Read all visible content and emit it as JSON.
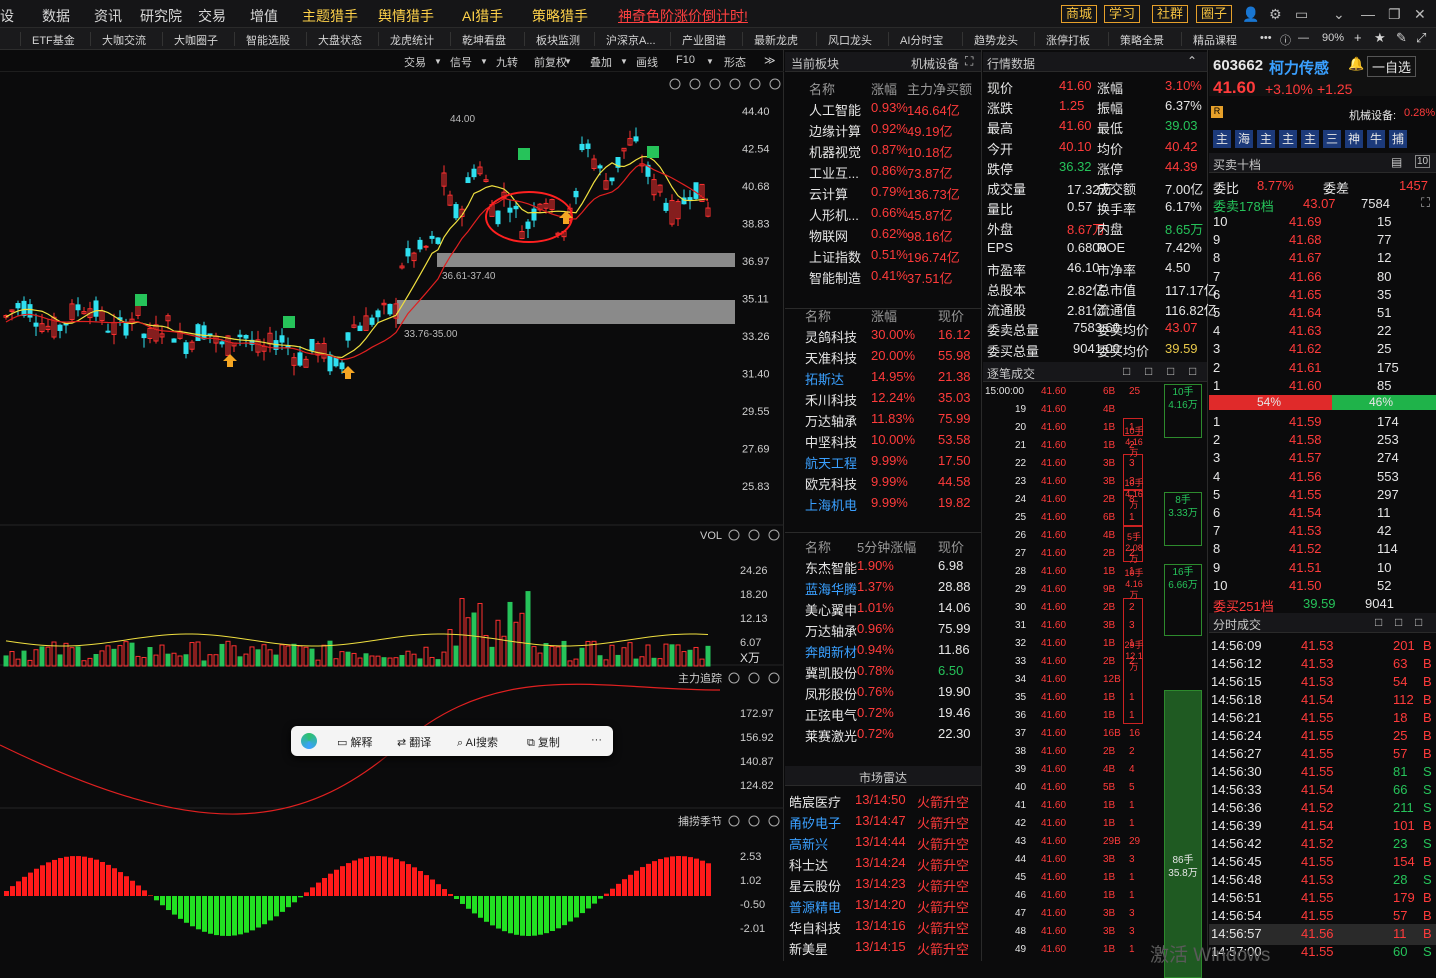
{
  "menu": [
    "设",
    "数据",
    "资讯",
    "研究院",
    "交易",
    "增值",
    "主题猎手",
    "舆情猎手",
    "AI猎手",
    "策略猎手"
  ],
  "promo": "神奇色阶涨价倒计时!",
  "top_buttons": [
    "商城",
    "学习",
    "社群",
    "圈子"
  ],
  "nav": [
    "",
    "ETF基金",
    "大咖交流",
    "大咖圈子",
    "智能选股",
    "大盘状态",
    "龙虎统计",
    "乾坤看盘",
    "板块监测",
    "沪深京A...",
    "产业图谱",
    "最新龙虎",
    "风口龙头",
    "AI分时宝",
    "趋势龙头",
    "涨停打板",
    "策略全景",
    "精品课程"
  ],
  "zoom": "90%",
  "chart_toolbar": [
    "交易",
    "信号",
    "九转",
    "前复权",
    "叠加",
    "画线",
    "F10",
    "形态"
  ],
  "price_axis": [
    "44.40",
    "42.54",
    "40.68",
    "38.83",
    "36.97",
    "35.11",
    "33.26",
    "31.40",
    "29.55",
    "27.69",
    "25.83"
  ],
  "price_marks": {
    "high": "44.00",
    "zone1": "36.61-37.40",
    "zone2": "33.76-35.00"
  },
  "vol": {
    "label": "VOL",
    "axis": [
      "24.26",
      "18.20",
      "12.13",
      "6.07"
    ],
    "unit": "X万"
  },
  "main_track": {
    "label": "主力追踪",
    "axis": [
      "172.97",
      "156.92",
      "140.87",
      "124.82"
    ]
  },
  "season": {
    "label": "捕捞季节",
    "axis": [
      "2.53",
      "1.02",
      "-0.50",
      "-2.01"
    ]
  },
  "ctx_menu": [
    "解释",
    "翻译",
    "AI搜索",
    "复制",
    "···"
  ],
  "sector": {
    "title": "当前板块",
    "current": "机械设备",
    "cols": [
      "名称",
      "涨幅",
      "主力净买额"
    ],
    "rows": [
      [
        "人工智能",
        "0.93%",
        "146.64亿"
      ],
      [
        "边缘计算",
        "0.92%",
        "49.19亿"
      ],
      [
        "机器视觉",
        "0.87%",
        "10.18亿"
      ],
      [
        "工业互...",
        "0.86%",
        "73.87亿"
      ],
      [
        "云计算",
        "0.79%",
        "136.73亿"
      ],
      [
        "人形机...",
        "0.66%",
        "45.87亿"
      ],
      [
        "物联网",
        "0.62%",
        "98.16亿"
      ],
      [
        "上证指数",
        "0.51%",
        "196.74亿"
      ],
      [
        "智能制造",
        "0.41%",
        "37.51亿"
      ]
    ]
  },
  "leaders": {
    "cols": [
      "名称",
      "涨幅",
      "现价"
    ],
    "rows": [
      [
        "灵鸽科技",
        "30.00%",
        "16.12"
      ],
      [
        "天准科技",
        "20.00%",
        "55.98"
      ],
      [
        "拓斯达",
        "14.95%",
        "21.38"
      ],
      [
        "禾川科技",
        "12.24%",
        "35.03"
      ],
      [
        "万达轴承",
        "11.83%",
        "75.99"
      ],
      [
        "中坚科技",
        "10.00%",
        "53.58"
      ],
      [
        "航天工程",
        "9.99%",
        "17.50"
      ],
      [
        "欧克科技",
        "9.99%",
        "44.58"
      ],
      [
        "上海机电",
        "9.99%",
        "19.82"
      ]
    ]
  },
  "five_min": {
    "cols": [
      "名称",
      "5分钟涨幅",
      "现价"
    ],
    "rows": [
      [
        "东杰智能",
        "1.90%",
        "6.98"
      ],
      [
        "蓝海华腾",
        "1.37%",
        "28.88"
      ],
      [
        "美心翼申",
        "1.01%",
        "14.06"
      ],
      [
        "万达轴承",
        "0.96%",
        "75.99"
      ],
      [
        "奔朗新材",
        "0.94%",
        "11.86"
      ],
      [
        "冀凯股份",
        "0.78%",
        "6.50"
      ],
      [
        "凤形股份",
        "0.76%",
        "19.90"
      ],
      [
        "正弦电气",
        "0.72%",
        "19.46"
      ],
      [
        "莱赛激光",
        "0.72%",
        "22.30"
      ]
    ]
  },
  "radar": {
    "title": "市场雷达",
    "rows": [
      [
        "皓宸医疗",
        "13/14:50",
        "火箭升空"
      ],
      [
        "甬矽电子",
        "13/14:47",
        "火箭升空"
      ],
      [
        "高新兴",
        "13/14:44",
        "火箭升空"
      ],
      [
        "科士达",
        "13/14:24",
        "火箭升空"
      ],
      [
        "星云股份",
        "13/14:23",
        "火箭升空"
      ],
      [
        "普源精电",
        "13/14:20",
        "火箭升空"
      ],
      [
        "华自科技",
        "13/14:16",
        "火箭升空"
      ],
      [
        "新美星",
        "13/14:15",
        "火箭升空"
      ]
    ]
  },
  "quote": {
    "title": "行情数据",
    "rows": [
      [
        "现价",
        "41.60",
        "涨幅",
        "3.10%"
      ],
      [
        "涨跌",
        "1.25",
        "振幅",
        "6.37%"
      ],
      [
        "最高",
        "41.60",
        "最低",
        "39.03"
      ],
      [
        "今开",
        "40.10",
        "均价",
        "40.42"
      ],
      [
        "跌停",
        "36.32",
        "涨停",
        "44.39"
      ],
      [
        "成交量",
        "17.32万",
        "成交额",
        "7.00亿"
      ],
      [
        "量比",
        "0.57",
        "换手率",
        "6.17%"
      ],
      [
        "外盘",
        "8.67万",
        "内盘",
        "8.65万"
      ],
      [
        "EPS",
        "0.6800",
        "ROE",
        "7.42%"
      ],
      [
        "市盈率",
        "46.10",
        "市净率",
        "4.50"
      ],
      [
        "总股本",
        "2.82亿",
        "总市值",
        "117.17亿"
      ],
      [
        "流通股",
        "2.81亿",
        "流通值",
        "116.82亿"
      ],
      [
        "委卖总量",
        "7583.60",
        "委卖均价",
        "43.07"
      ],
      [
        "委买总量",
        "9041.00",
        "委买均价",
        "39.59"
      ]
    ]
  },
  "ticks": {
    "title": "逐笔成交",
    "first_time": "15:00:00",
    "rows": [
      [
        "",
        "41.60",
        "6B",
        "25"
      ],
      [
        "19",
        "41.60",
        "4B",
        ""
      ],
      [
        "20",
        "41.60",
        "1B",
        "1"
      ],
      [
        "21",
        "41.60",
        "1B",
        "2"
      ],
      [
        "22",
        "41.60",
        "3B",
        "3"
      ],
      [
        "23",
        "41.60",
        "3B",
        "3"
      ],
      [
        "24",
        "41.60",
        "2B",
        "8"
      ],
      [
        "25",
        "41.60",
        "6B",
        "1"
      ],
      [
        "26",
        "41.60",
        "4B",
        ""
      ],
      [
        "27",
        "41.60",
        "2B",
        "2"
      ],
      [
        "28",
        "41.60",
        "1B",
        "1"
      ],
      [
        "29",
        "41.60",
        "9B",
        ""
      ],
      [
        "30",
        "41.60",
        "2B",
        "2"
      ],
      [
        "31",
        "41.60",
        "3B",
        "3"
      ],
      [
        "32",
        "41.60",
        "1B",
        "1"
      ],
      [
        "33",
        "41.60",
        "2B",
        "2"
      ],
      [
        "34",
        "41.60",
        "12B",
        ""
      ],
      [
        "35",
        "41.60",
        "1B",
        "1"
      ],
      [
        "36",
        "41.60",
        "1B",
        "1"
      ],
      [
        "37",
        "41.60",
        "16B",
        "16"
      ],
      [
        "38",
        "41.60",
        "2B",
        "2"
      ],
      [
        "39",
        "41.60",
        "4B",
        "4"
      ],
      [
        "40",
        "41.60",
        "5B",
        "5"
      ],
      [
        "41",
        "41.60",
        "1B",
        "1"
      ],
      [
        "42",
        "41.60",
        "1B",
        "1"
      ],
      [
        "43",
        "41.60",
        "29B",
        "29"
      ],
      [
        "44",
        "41.60",
        "3B",
        "3"
      ],
      [
        "45",
        "41.60",
        "1B",
        "1"
      ],
      [
        "46",
        "41.60",
        "1B",
        "1"
      ],
      [
        "47",
        "41.60",
        "3B",
        "3"
      ],
      [
        "48",
        "41.60",
        "3B",
        "3"
      ],
      [
        "49",
        "41.60",
        "1B",
        "1"
      ]
    ],
    "blocks_a": [
      [
        "10手",
        "4.16万"
      ],
      [
        "10手",
        "4.16万"
      ],
      [
        "5手",
        "2.08万"
      ],
      [
        "10手",
        "4.16万"
      ],
      [
        "29手",
        "12.1万"
      ]
    ],
    "blocks_b": [
      [
        "10手",
        "4.16万"
      ],
      [
        "8手",
        "3.33万"
      ],
      [
        "16手",
        "6.66万"
      ],
      [
        "86手",
        "35.8万"
      ]
    ]
  },
  "stock": {
    "code": "603662",
    "name": "柯力传感",
    "price": "41.60",
    "chg_pct": "+3.10%",
    "chg": "+1.25",
    "self_select": "一自选",
    "industry": "机械设备:",
    "industry_pct": "0.28%",
    "tabs": [
      "主",
      "海",
      "主",
      "主",
      "主",
      "三",
      "神",
      "牛",
      "捕"
    ]
  },
  "book": {
    "title": "买卖十档",
    "ratio_label": "委比",
    "ratio": "8.77%",
    "diff_label": "委差",
    "diff": "1457",
    "sell_label": "委卖178档",
    "sell_avg": "43.07",
    "sell_total": "7584",
    "asks": [
      [
        "10",
        "41.69",
        "15"
      ],
      [
        "9",
        "41.68",
        "77"
      ],
      [
        "8",
        "41.67",
        "12"
      ],
      [
        "7",
        "41.66",
        "80"
      ],
      [
        "6",
        "41.65",
        "35"
      ],
      [
        "5",
        "41.64",
        "51"
      ],
      [
        "4",
        "41.63",
        "22"
      ],
      [
        "3",
        "41.62",
        "25"
      ],
      [
        "2",
        "41.61",
        "175"
      ],
      [
        "1",
        "41.60",
        "85"
      ]
    ],
    "bar_left": "54%",
    "bar_right": "46%",
    "bids": [
      [
        "1",
        "41.59",
        "174"
      ],
      [
        "2",
        "41.58",
        "253"
      ],
      [
        "3",
        "41.57",
        "274"
      ],
      [
        "4",
        "41.56",
        "553"
      ],
      [
        "5",
        "41.55",
        "297"
      ],
      [
        "6",
        "41.54",
        "11"
      ],
      [
        "7",
        "41.53",
        "42"
      ],
      [
        "8",
        "41.52",
        "114"
      ],
      [
        "9",
        "41.51",
        "10"
      ],
      [
        "10",
        "41.50",
        "52"
      ]
    ],
    "buy_label": "委买251档",
    "buy_avg": "39.59",
    "buy_total": "9041"
  },
  "intraday": {
    "title": "分时成交",
    "rows": [
      [
        "14:56:09",
        "41.53",
        "201",
        "B"
      ],
      [
        "14:56:12",
        "41.53",
        "63",
        "B"
      ],
      [
        "14:56:15",
        "41.53",
        "54",
        "B"
      ],
      [
        "14:56:18",
        "41.54",
        "112",
        "B"
      ],
      [
        "14:56:21",
        "41.55",
        "18",
        "B"
      ],
      [
        "14:56:24",
        "41.55",
        "25",
        "B"
      ],
      [
        "14:56:27",
        "41.55",
        "57",
        "B"
      ],
      [
        "14:56:30",
        "41.55",
        "81",
        "S"
      ],
      [
        "14:56:33",
        "41.54",
        "66",
        "S"
      ],
      [
        "14:56:36",
        "41.52",
        "211",
        "S"
      ],
      [
        "14:56:39",
        "41.54",
        "101",
        "B"
      ],
      [
        "14:56:42",
        "41.52",
        "23",
        "S"
      ],
      [
        "14:56:45",
        "41.55",
        "154",
        "B"
      ],
      [
        "14:56:48",
        "41.53",
        "28",
        "S"
      ],
      [
        "14:56:51",
        "41.55",
        "179",
        "B"
      ],
      [
        "14:56:54",
        "41.55",
        "57",
        "B"
      ],
      [
        "14:56:57",
        "41.56",
        "11",
        "B"
      ],
      [
        "14:57:00",
        "41.55",
        "60",
        "S"
      ]
    ]
  },
  "watermark": "激活 Windows"
}
